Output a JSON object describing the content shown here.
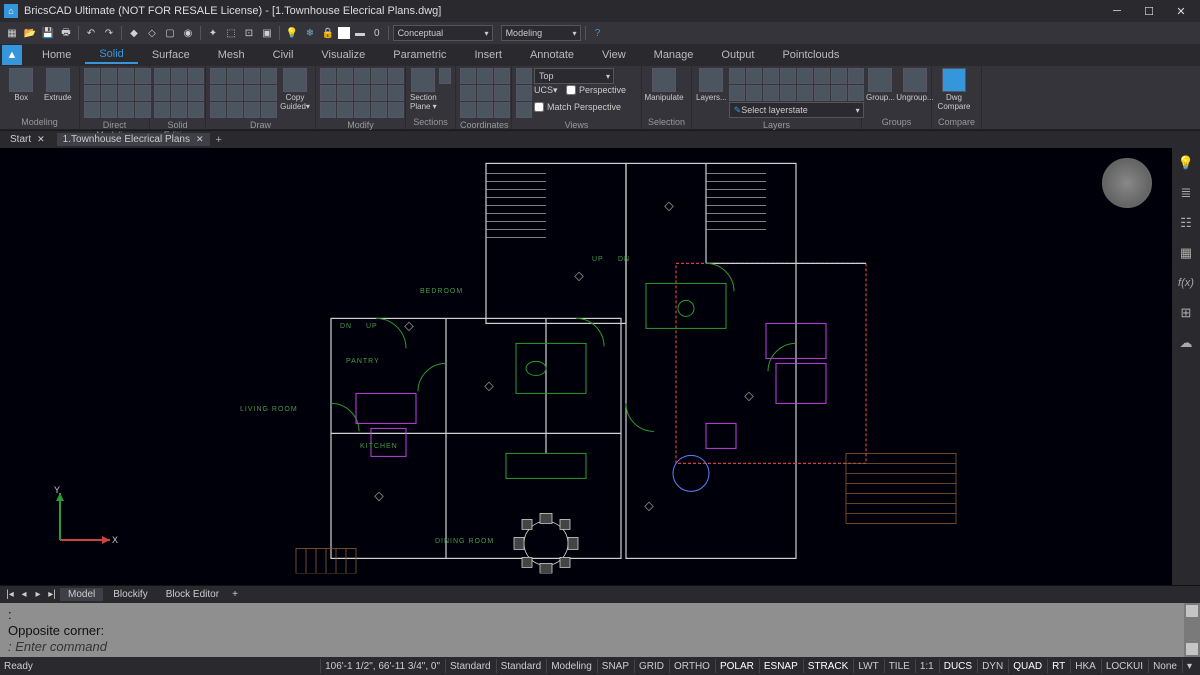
{
  "titlebar": {
    "title": "BricsCAD Ultimate (NOT FOR RESALE License) - [1.Townhouse Elecrical Plans.dwg]"
  },
  "qat": {
    "zero": "0"
  },
  "menu": {
    "items": [
      "Home",
      "Solid",
      "Surface",
      "Mesh",
      "Civil",
      "Visualize",
      "Parametric",
      "Insert",
      "Annotate",
      "View",
      "Manage",
      "Output",
      "Pointclouds"
    ],
    "active": 1
  },
  "ribbon": {
    "panels": [
      "Modeling",
      "Direct Modeling",
      "Solid Editing",
      "Draw",
      "Modify",
      "Sections",
      "Coordinates",
      "Views",
      "Selection",
      "Layers",
      "Groups",
      "Compare"
    ],
    "box": "Box",
    "extrude": "Extrude",
    "copyguided": "Copy Guided▾",
    "sectionplane": "Section Plane ▾",
    "manipulate": "Manipulate",
    "layers": "Layers...",
    "group": "Group...",
    "ungroup": "Ungroup...",
    "dwgcompare": "Dwg Compare",
    "view_top": "Top",
    "view_ucs": "UCS▾",
    "view_persp": "Perspective",
    "view_match": "Match Perspective",
    "layerstate": "Select layerstate",
    "visualstyle": "Conceptual",
    "workspace": "Modeling"
  },
  "doctabs": {
    "start": "Start",
    "file": "1.Townhouse Elecrical Plans"
  },
  "layouts": {
    "model": "Model",
    "blockify": "Blockify",
    "blockeditor": "Block Editor"
  },
  "cmd": {
    "line1": ":",
    "line2": "Opposite corner:",
    "prompt": ": Enter command"
  },
  "status": {
    "ready": "Ready",
    "coords": "106'-1 1/2\", 66'-11 3/4\", 0\"",
    "std1": "Standard",
    "std2": "Standard",
    "std3": "Modeling",
    "toggles": [
      "SNAP",
      "GRID",
      "ORTHO",
      "POLAR",
      "ESNAP",
      "STRACK",
      "LWT",
      "TILE",
      "1:1",
      "DUCS",
      "DYN",
      "QUAD",
      "RT",
      "HKA",
      "LOCKUI",
      "None"
    ]
  },
  "rooms": {
    "bedroom": "BEDROOM",
    "living": "LIVING ROOM",
    "kitchen": "KITCHEN",
    "dining": "DINING ROOM",
    "pantry": "PANTRY",
    "up": "UP",
    "dn": "DN"
  },
  "axes": {
    "x": "X",
    "y": "Y"
  }
}
